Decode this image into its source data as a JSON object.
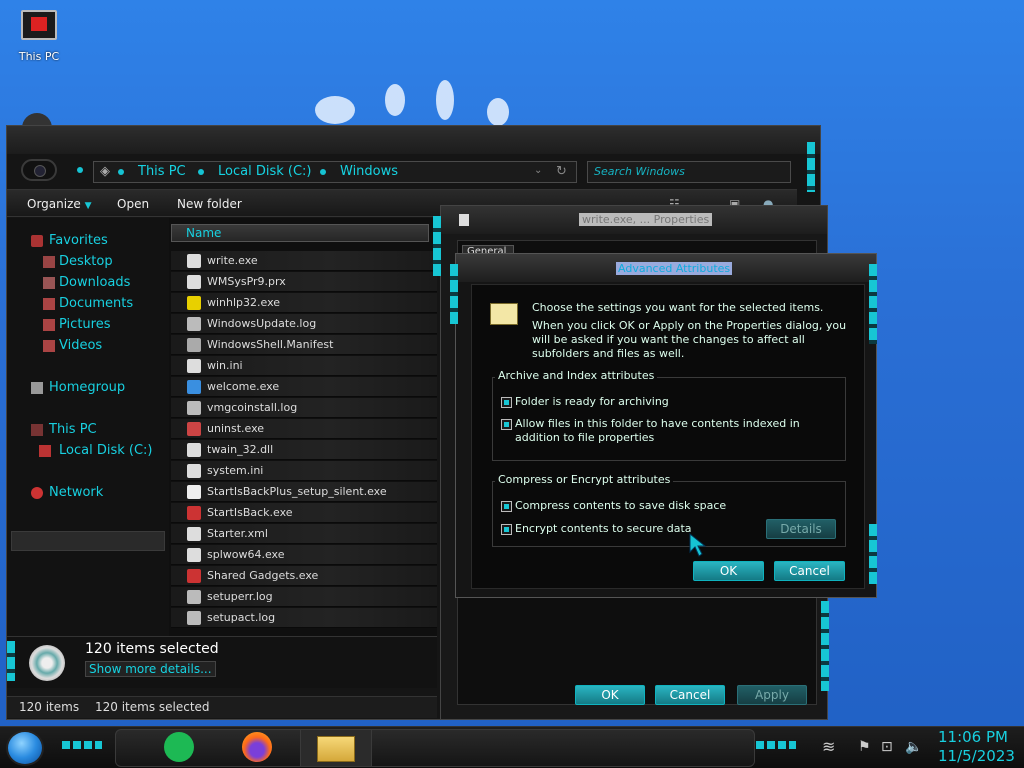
{
  "desktop": {
    "icon_label": "This PC"
  },
  "explorer": {
    "address": {
      "crumb_1": "This PC",
      "crumb_2": "Local Disk (C:)",
      "crumb_3": "Windows"
    },
    "search_placeholder": "Search Windows",
    "toolbar": {
      "organize": "Organize",
      "open": "Open",
      "new_folder": "New folder"
    },
    "nav": {
      "favorites": "Favorites",
      "desktop": "Desktop",
      "downloads": "Downloads",
      "documents": "Documents",
      "pictures": "Pictures",
      "videos": "Videos",
      "homegroup": "Homegroup",
      "this_pc": "This PC",
      "local_disk": "Local Disk (C:)",
      "network": "Network"
    },
    "column_name": "Name",
    "files": [
      {
        "name": "write.exe"
      },
      {
        "name": "WMSysPr9.prx"
      },
      {
        "name": "winhlp32.exe"
      },
      {
        "name": "WindowsUpdate.log"
      },
      {
        "name": "WindowsShell.Manifest"
      },
      {
        "name": "win.ini"
      },
      {
        "name": "welcome.exe"
      },
      {
        "name": "vmgcoinstall.log"
      },
      {
        "name": "uninst.exe"
      },
      {
        "name": "twain_32.dll"
      },
      {
        "name": "system.ini"
      },
      {
        "name": "StartIsBackPlus_setup_silent.exe"
      },
      {
        "name": "StartIsBack.exe"
      },
      {
        "name": "Starter.xml"
      },
      {
        "name": "splwow64.exe"
      },
      {
        "name": "Shared Gadgets.exe"
      },
      {
        "name": "setuperr.log"
      },
      {
        "name": "setupact.log"
      }
    ],
    "details": {
      "title": "120 items selected",
      "show_more": "Show more details..."
    },
    "status": {
      "count": "120 items",
      "selected": "120 items selected"
    }
  },
  "properties": {
    "title": "write.exe, ... Properties",
    "tab_general": "General",
    "ok": "OK",
    "cancel": "Cancel",
    "apply": "Apply"
  },
  "advanced": {
    "title": "Advanced Attributes",
    "intro_1": "Choose the settings you want for the selected items.",
    "intro_2": "When you click OK or Apply on the Properties dialog, you will be asked if you want the changes to affect all subfolders and files as well.",
    "archive_group": "Archive and Index attributes",
    "archive_ready": "Folder is ready for archiving",
    "archive_ready_checked": true,
    "index_allow": "Allow files in this folder to have contents indexed in addition to file properties",
    "index_allow_checked": true,
    "compress_group": "Compress or Encrypt attributes",
    "compress": "Compress contents to save disk space",
    "compress_checked": true,
    "encrypt": "Encrypt contents to secure data",
    "encrypt_checked": true,
    "details": "Details",
    "ok": "OK",
    "cancel": "Cancel"
  },
  "taskbar": {
    "time": "11:06 PM",
    "date": "11/5/2023"
  },
  "colors": {
    "accent": "#17c6d4",
    "desktop_bg": "#2b6fcf"
  }
}
